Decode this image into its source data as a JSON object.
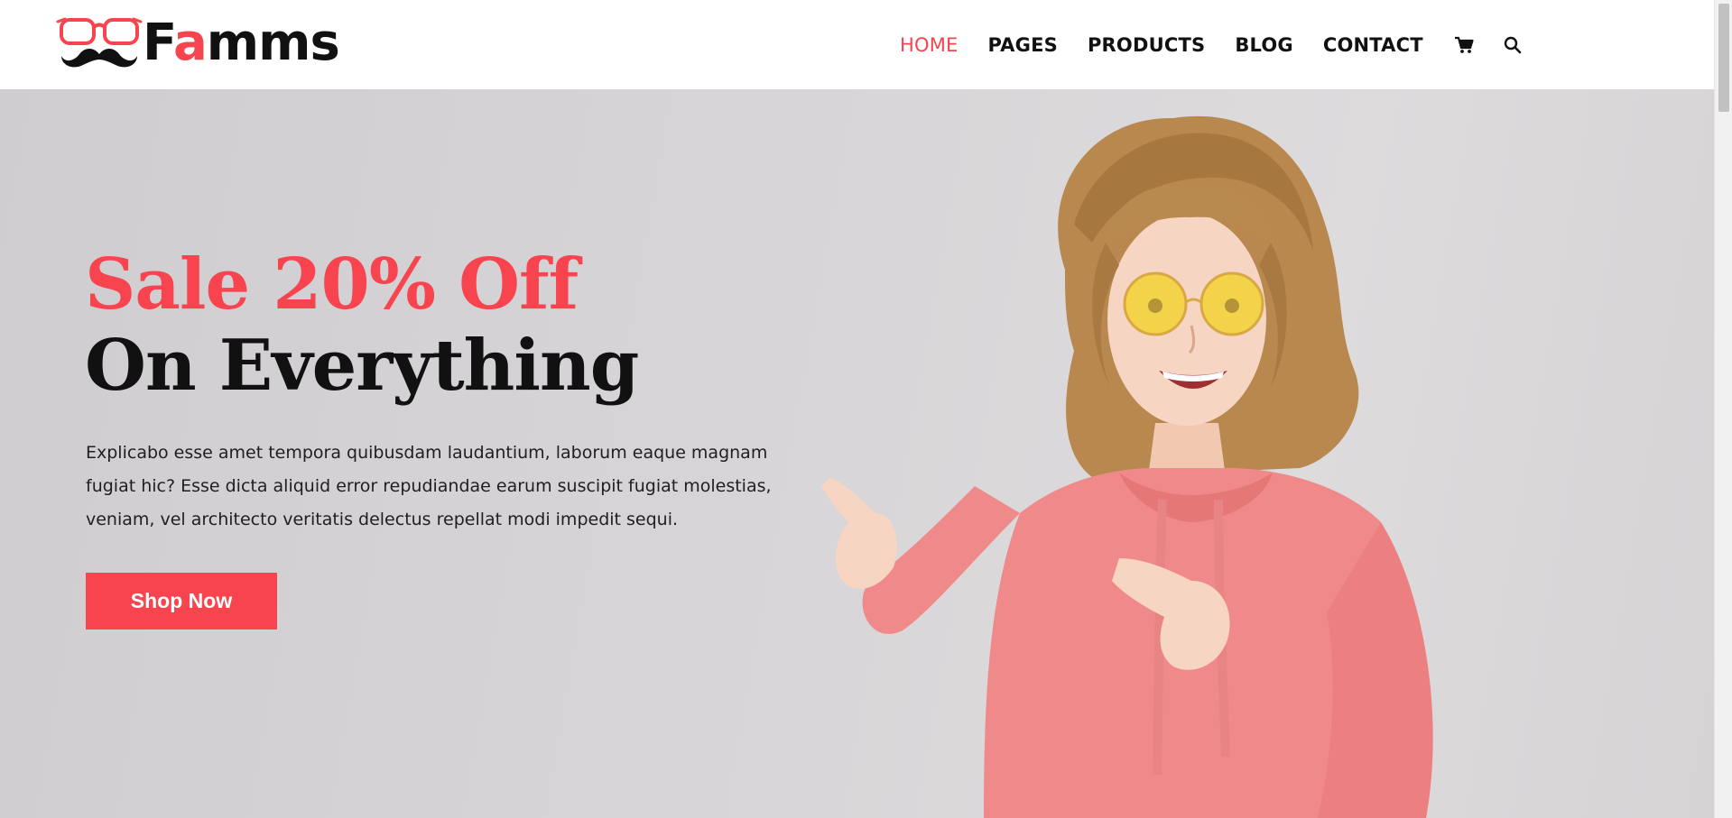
{
  "brand": {
    "name_prefix": "F",
    "name_accent": "a",
    "name_suffix": "mms",
    "logo_icon": "glasses-mustache-icon",
    "accent_color": "#f7444e"
  },
  "nav": {
    "items": [
      {
        "label": "HOME",
        "active": true
      },
      {
        "label": "PAGES",
        "active": false
      },
      {
        "label": "PRODUCTS",
        "active": false
      },
      {
        "label": "BLOG",
        "active": false
      },
      {
        "label": "CONTACT",
        "active": false
      }
    ],
    "cart_icon": "cart-icon",
    "search_icon": "search-icon"
  },
  "hero": {
    "title": "Sale 20% Off",
    "subtitle": "On Everything",
    "text_line1": "Explicabo esse amet tempora quibusdam laudantium, laborum eaque magnam",
    "text_line2": "fugiat hic? Esse dicta aliquid error repudiandae earum suscipit fugiat molestias,",
    "text_line3": "veniam, vel architecto veritatis delectus repellat modi impedit sequi.",
    "button_label": "Shop Now",
    "image_subject": "woman-in-pink-hoodie-pointing"
  }
}
